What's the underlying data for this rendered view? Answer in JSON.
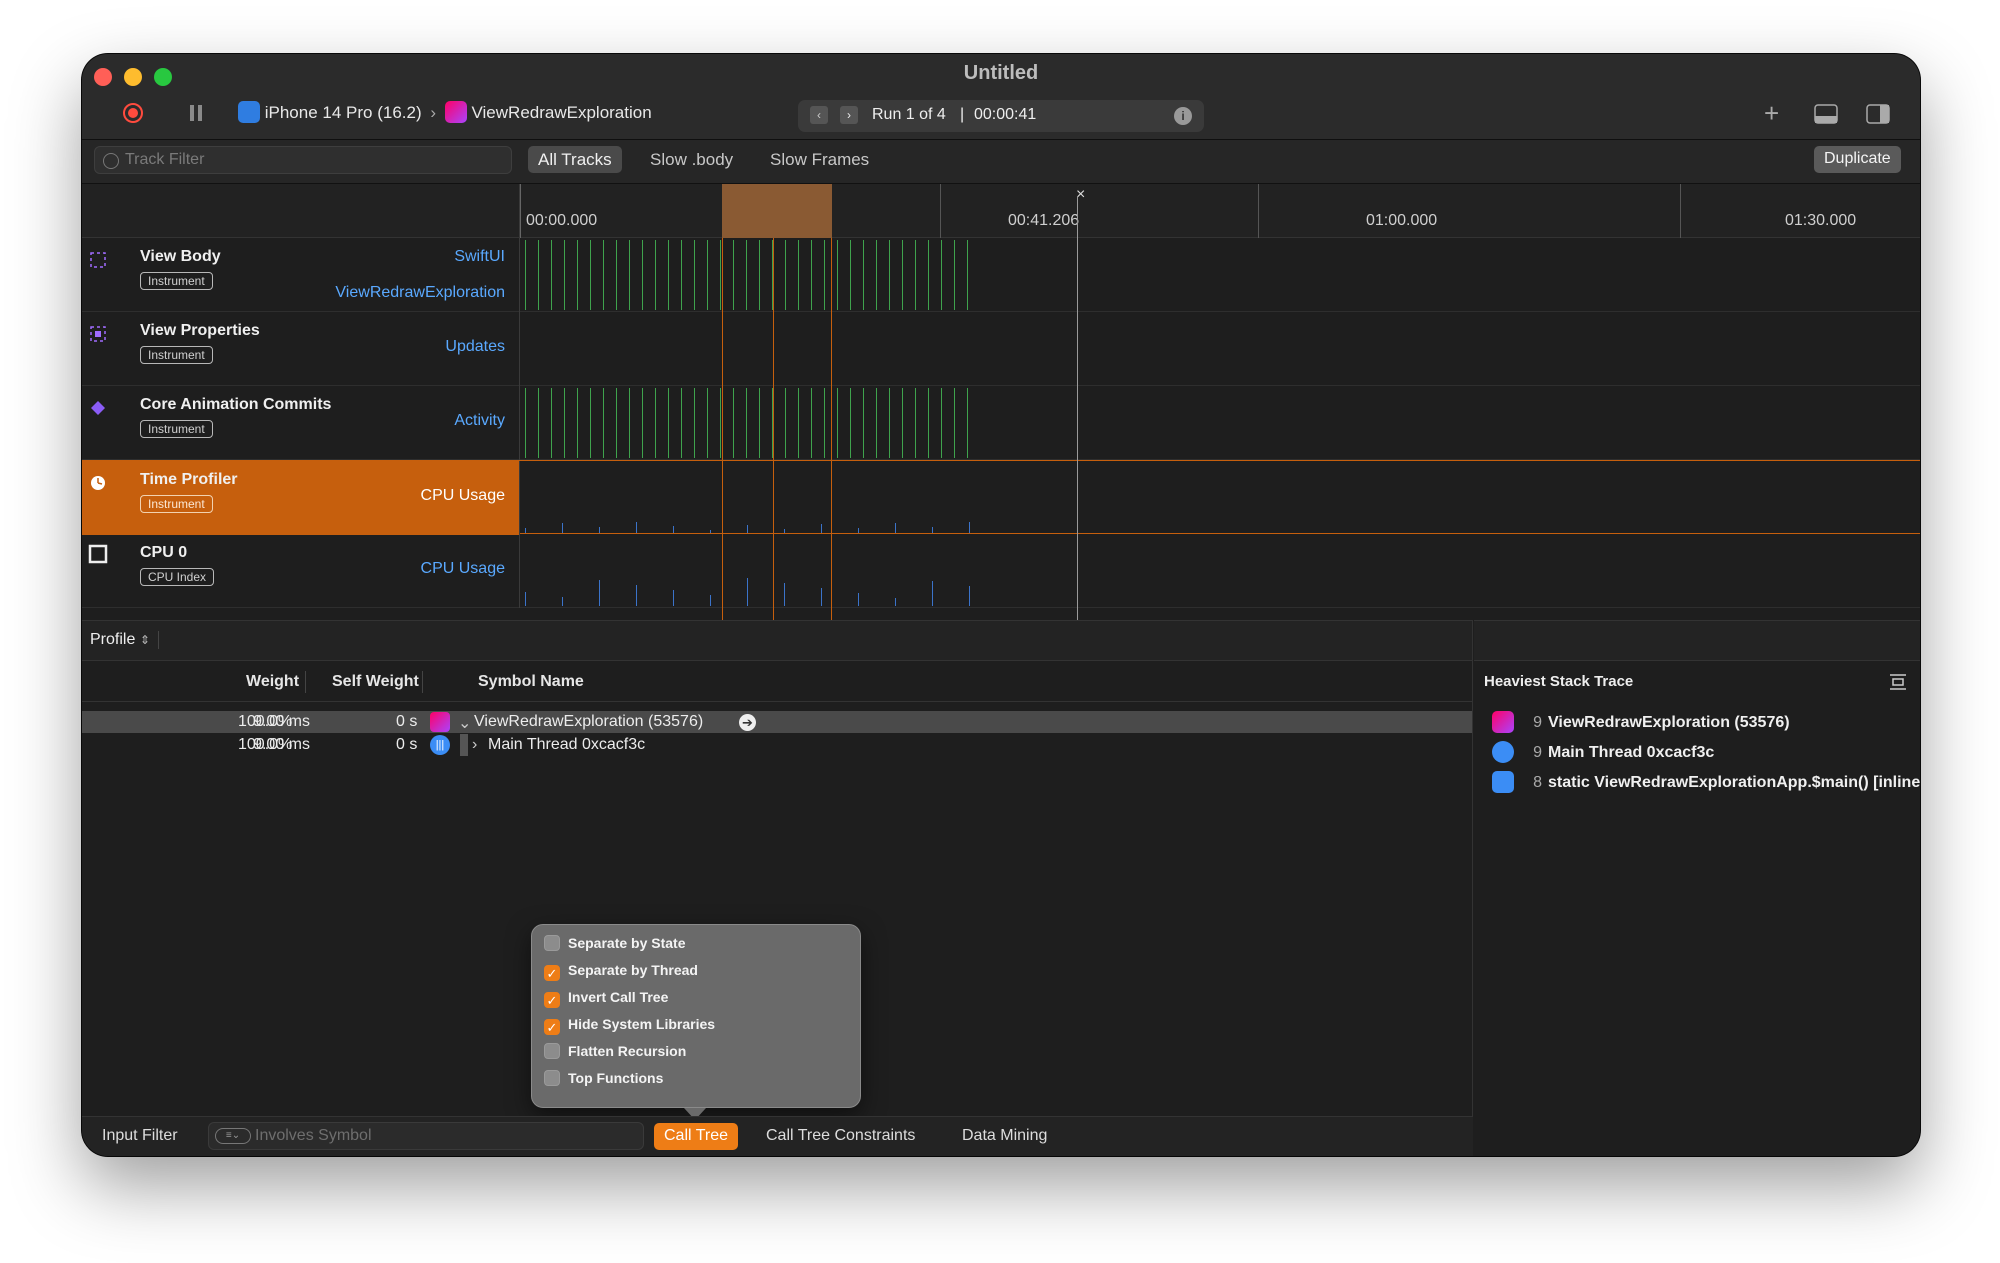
{
  "window": {
    "title": "Untitled"
  },
  "toolbar": {
    "device": "iPhone 14 Pro (16.2)",
    "target": "ViewRedrawExploration",
    "run": "Run 1 of 4",
    "time": "00:00:41"
  },
  "filter": {
    "placeholder": "Track Filter",
    "tabs": [
      "All Tracks",
      "Slow .body",
      "Slow Frames"
    ],
    "selected_tab": "All Tracks",
    "duplicate": "Duplicate"
  },
  "ruler": {
    "labels": [
      "00:00.000",
      "00:41.206",
      "01:00.000",
      "01:30.000"
    ]
  },
  "tracks": [
    {
      "name": "View Body",
      "badge": "Instrument",
      "sub1": "SwiftUI",
      "sub2": "ViewRedrawExploration",
      "icon": "view-body-icon"
    },
    {
      "name": "View Properties",
      "badge": "Instrument",
      "sub1": "Updates",
      "sub2": "",
      "icon": "view-properties-icon"
    },
    {
      "name": "Core Animation Commits",
      "badge": "Instrument",
      "sub1": "Activity",
      "sub2": "",
      "icon": "core-animation-icon"
    },
    {
      "name": "Time Profiler",
      "badge": "Instrument",
      "sub1": "CPU Usage",
      "sub2": "",
      "icon": "time-profiler-icon"
    },
    {
      "name": "CPU 0",
      "badge": "CPU Index",
      "sub1": "CPU Usage",
      "sub2": "",
      "icon": "cpu-icon"
    }
  ],
  "profile": {
    "selector": "Profile",
    "columns": {
      "weight": "Weight",
      "self_weight": "Self Weight",
      "symbol": "Symbol Name"
    },
    "rows": [
      {
        "weight": "9.00 ms",
        "percent": "100.0%",
        "self": "0 s",
        "symbol": "ViewRedrawExploration (53576)",
        "expanded": true
      },
      {
        "weight": "9.00 ms",
        "percent": "100.0%",
        "self": "0 s",
        "symbol": "Main Thread  0xcacf3c",
        "expanded": false
      }
    ]
  },
  "popover": {
    "options": [
      {
        "label": "Separate by State",
        "checked": false
      },
      {
        "label": "Separate by Thread",
        "checked": true
      },
      {
        "label": "Invert Call Tree",
        "checked": true
      },
      {
        "label": "Hide System Libraries",
        "checked": true
      },
      {
        "label": "Flatten Recursion",
        "checked": false
      },
      {
        "label": "Top Functions",
        "checked": false
      }
    ]
  },
  "bottombar": {
    "input_filter": "Input Filter",
    "involves_placeholder": "Involves Symbol",
    "call_tree": "Call Tree",
    "constraints": "Call Tree Constraints",
    "data_mining": "Data Mining"
  },
  "heaviest": {
    "title": "Heaviest Stack Trace",
    "frames": [
      {
        "count": "9",
        "label": "ViewRedrawExploration (53576)"
      },
      {
        "count": "9",
        "label": "Main Thread  0xcacf3c"
      },
      {
        "count": "8",
        "label": "static ViewRedrawExplorationApp.$main() [inlined]"
      }
    ]
  },
  "colors": {
    "accent": "#c65f0d",
    "selection_orange": "#ee7d16",
    "link_blue": "#5aa9ff",
    "event_green": "#3fa34d"
  }
}
